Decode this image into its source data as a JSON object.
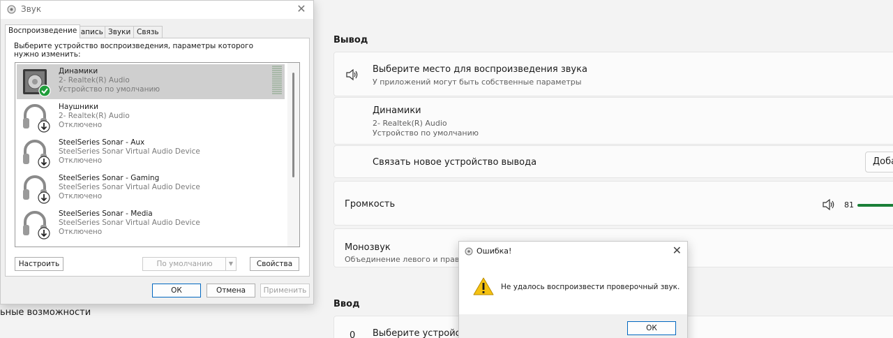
{
  "settings": {
    "output_title": "Вывод",
    "choose_place": {
      "title": "Выберите место для воспроизведения звука",
      "subtitle": "У приложений могут быть собственные параметры"
    },
    "device": {
      "name": "Динамики",
      "line1": "2- Realtek(R) Audio",
      "line2": "Устройство по умолчанию"
    },
    "pair": {
      "label": "Связать новое устройство вывода",
      "button_label": "Доба"
    },
    "volume": {
      "label": "Громкость",
      "value": "81",
      "level_percent": 81
    },
    "mono": {
      "title": "Монозвук",
      "subtitle": "Объединение левого и правого"
    },
    "input_title": "Ввод",
    "input_choose": {
      "title": "Выберите устройств",
      "glyph": "0"
    },
    "side_fragment": "ьные возможности"
  },
  "sound_dialog": {
    "title": "Звук",
    "tabs": [
      "Воспроизведение",
      "Запись",
      "Звуки",
      "Связь"
    ],
    "active_tab": 0,
    "instruction": "Выберите устройство воспроизведения, параметры которого нужно изменить:",
    "devices": [
      {
        "name": "Динамики",
        "driver": "2- Realtek(R) Audio",
        "state": "Устройство по умолчанию",
        "icon": "speaker-icon",
        "badge": "check",
        "selected": true
      },
      {
        "name": "Наушники",
        "driver": "2- Realtek(R) Audio",
        "state": "Отключено",
        "icon": "headphones-icon",
        "badge": "down",
        "selected": false
      },
      {
        "name": "SteelSeries Sonar - Aux",
        "driver": "SteelSeries Sonar Virtual Audio Device",
        "state": "Отключено",
        "icon": "headphones-icon",
        "badge": "down",
        "selected": false
      },
      {
        "name": "SteelSeries Sonar - Gaming",
        "driver": "SteelSeries Sonar Virtual Audio Device",
        "state": "Отключено",
        "icon": "headphones-icon",
        "badge": "down",
        "selected": false
      },
      {
        "name": "SteelSeries Sonar - Media",
        "driver": "SteelSeries Sonar Virtual Audio Device",
        "state": "Отключено",
        "icon": "headphones-icon",
        "badge": "down",
        "selected": false
      }
    ],
    "buttons": {
      "configure": "Настроить",
      "set_default": "По умолчанию",
      "properties": "Свойства",
      "ok": "ОК",
      "cancel": "Отмена",
      "apply": "Применить"
    }
  },
  "error_dialog": {
    "title": "Ошибка!",
    "message": "Не удалось воспроизвести проверочный звук.",
    "ok": "ОК"
  },
  "colors": {
    "accent_green": "#1a7f37",
    "warning_yellow": "#f5c211",
    "check_green": "#1f9d3a"
  }
}
